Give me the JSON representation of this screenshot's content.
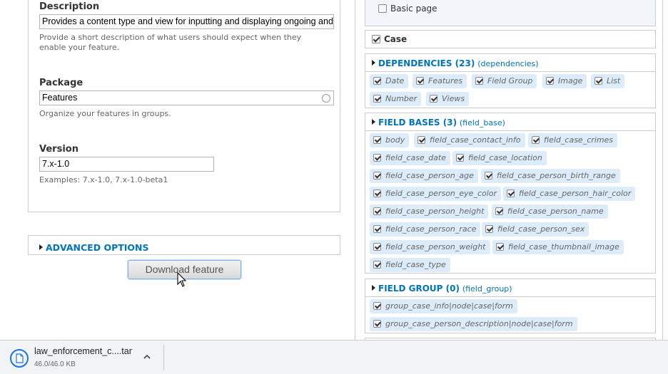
{
  "form": {
    "description": {
      "label": "Description",
      "value": "Provides a content type and view for inputting and displaying ongoing and",
      "help_line1": "Provide a short description of what users should expect when they",
      "help_line2": "enable your feature."
    },
    "package": {
      "label": "Package",
      "value": "Features",
      "help": "Organize your features in groups."
    },
    "version": {
      "label": "Version",
      "value": "7.x-1.0",
      "help": "Examples: 7.x-1.0, 7.x-1.0-beta1"
    },
    "advanced_options": "ADVANCED OPTIONS",
    "download_button": "Download feature"
  },
  "content_types": {
    "basic_page": {
      "label": "Basic page",
      "checked": false
    },
    "case": {
      "label": "Case",
      "checked": true
    }
  },
  "dependencies": {
    "title": "DEPENDENCIES (23)",
    "machine": "(dependencies)",
    "items": [
      "Date",
      "Features",
      "Field Group",
      "Image",
      "List",
      "Number",
      "Views"
    ]
  },
  "field_bases": {
    "title": "FIELD BASES (3)",
    "machine": "(field_base)",
    "items": [
      "body",
      "field_case_contact_info",
      "field_case_crimes",
      "field_case_date",
      "field_case_location",
      "field_case_person_age",
      "field_case_person_birth_range",
      "field_case_person_eye_color",
      "field_case_person_hair_color",
      "field_case_person_height",
      "field_case_person_name",
      "field_case_person_race",
      "field_case_person_sex",
      "field_case_person_weight",
      "field_case_thumbnail_image",
      "field_case_type"
    ]
  },
  "field_group": {
    "title": "FIELD GROUP (0)",
    "machine": "(field_group)",
    "items": [
      "group_case_info|node|case|form",
      "group_case_person_description|node|case|form"
    ]
  },
  "download_bar": {
    "file_name": "law_enforcement_c....tar",
    "file_size": "46.0/46.0 KB"
  },
  "colors": {
    "link": "#0074bd",
    "chip_bg": "#dcecfa"
  },
  "icons": [
    "spinner-icon",
    "triangle-right-icon",
    "checkbox-icon",
    "mouse-cursor-icon",
    "file-icon",
    "chevron-up-icon"
  ]
}
